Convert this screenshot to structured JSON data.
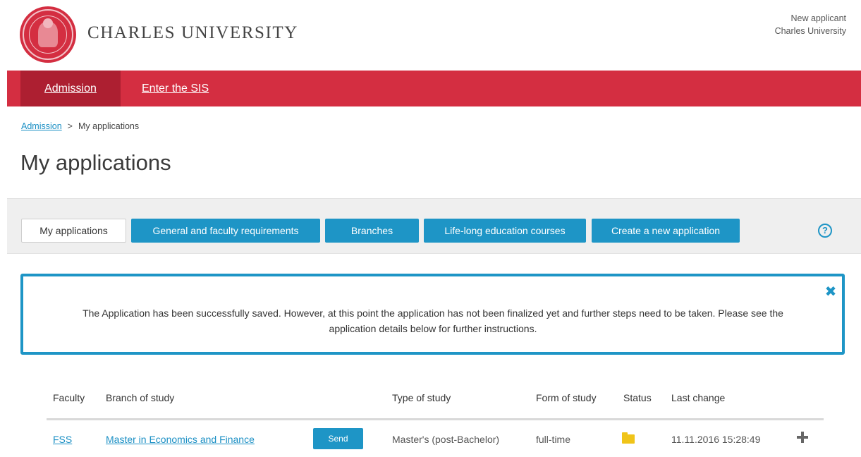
{
  "header": {
    "brand_name": "CHARLES UNIVERSITY",
    "user_name": "New applicant",
    "user_org": "Charles University"
  },
  "nav": {
    "items": [
      {
        "label": "Admission",
        "active": true
      },
      {
        "label": "Enter the SIS",
        "active": false
      }
    ]
  },
  "breadcrumb": {
    "items": [
      "Admission",
      "My applications"
    ],
    "separator": ">"
  },
  "page_title": "My applications",
  "toolbar": {
    "buttons": [
      {
        "label": "My applications",
        "style": "plain"
      },
      {
        "label": "General and faculty requirements",
        "style": "blue"
      },
      {
        "label": "Branches",
        "style": "blue"
      },
      {
        "label": "Life-long education courses",
        "style": "blue"
      },
      {
        "label": "Create a new application",
        "style": "blue"
      }
    ],
    "help_icon": "question-circle-icon",
    "help_glyph": "?"
  },
  "alert": {
    "message": "The Application has been successfully saved. However, at this point the application has not been finalized yet and further steps need to be taken. Please see the application details below for further instructions.",
    "close_icon": "close-x-icon",
    "close_glyph": "✖"
  },
  "table": {
    "columns": [
      "Faculty",
      "Branch of study",
      "Type of study",
      "Form of study",
      "Status",
      "Last change"
    ],
    "rows": [
      {
        "faculty": "FSS",
        "branch": "Master in Economics and Finance",
        "action": "Send",
        "type": "Master's (post-Bachelor)",
        "form": "full-time",
        "status_icon": "folder-icon",
        "last_change": "11.11.2016 15:28:49",
        "expand_icon": "plus-icon"
      }
    ]
  },
  "colors": {
    "brand_red": "#d42e41",
    "nav_active": "#ad1f31",
    "accent_blue": "#1e95c6",
    "link_blue": "#1a8fc4",
    "folder_yellow": "#f0c419"
  }
}
